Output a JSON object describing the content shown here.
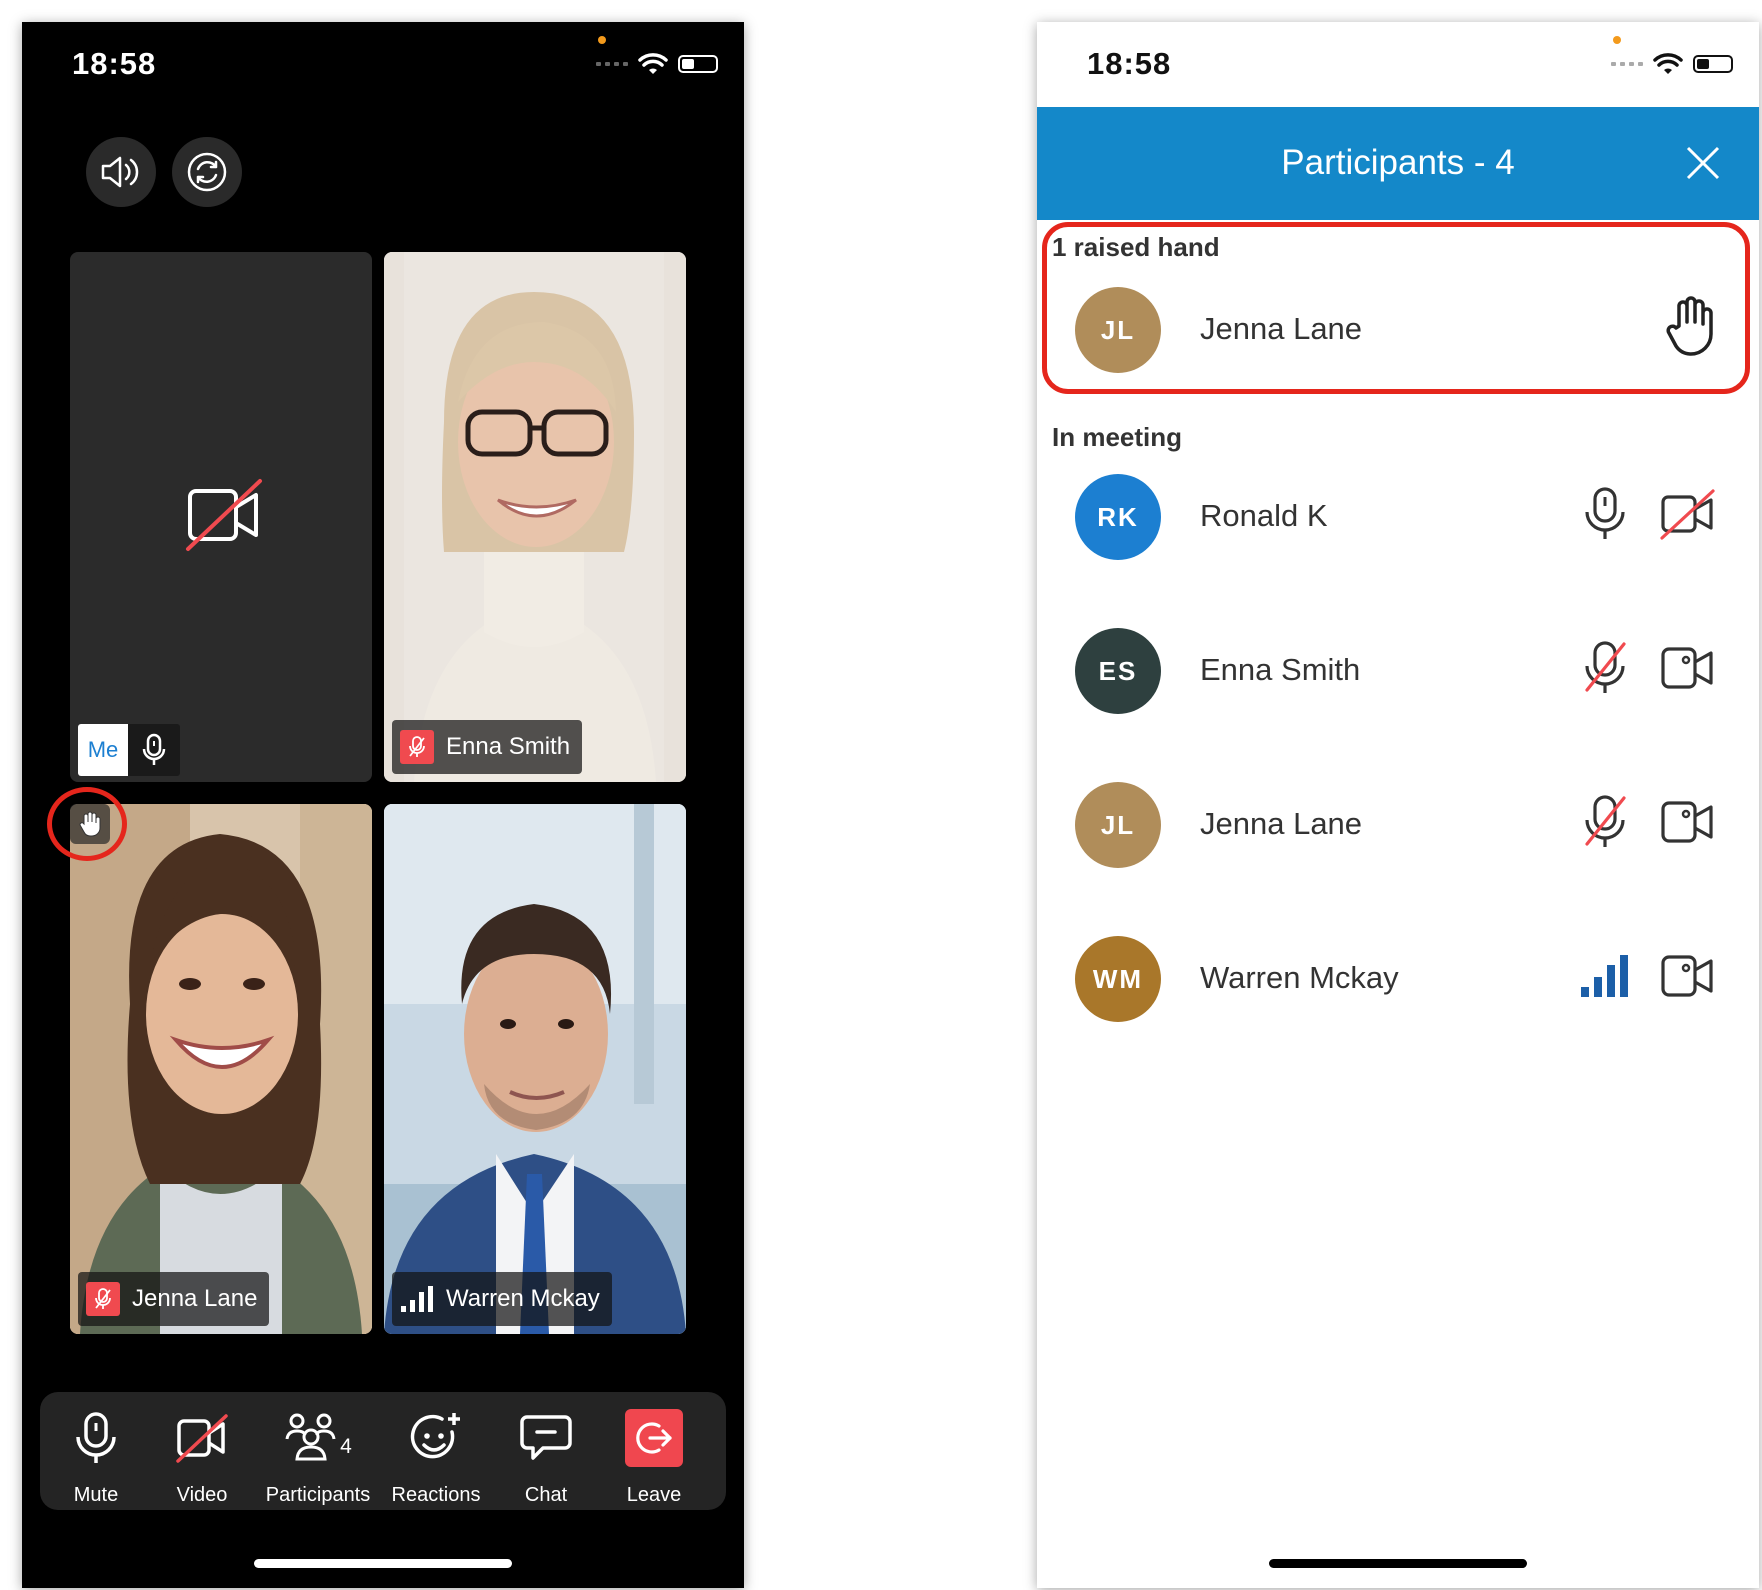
{
  "left_phone": {
    "status": {
      "time": "18:58"
    },
    "self_tile": {
      "me_label": "Me"
    },
    "tiles": [
      {
        "name": "Enna Smith"
      },
      {
        "name": "Jenna Lane"
      },
      {
        "name": "Warren Mckay"
      }
    ],
    "toolbar": {
      "mute": "Mute",
      "video": "Video",
      "participants": "Participants",
      "participants_count": "4",
      "reactions": "Reactions",
      "chat": "Chat",
      "leave": "Leave"
    }
  },
  "right_phone": {
    "status": {
      "time": "18:58"
    },
    "header": {
      "title": "Participants - 4"
    },
    "raised_section": {
      "label": "1 raised hand",
      "participant": {
        "initials": "JL",
        "name": "Jenna Lane",
        "color": "#b08d5a"
      }
    },
    "meeting_section": {
      "label": "In meeting",
      "participants": [
        {
          "initials": "RK",
          "name": "Ronald K",
          "color": "#1c7fd1",
          "mic": "on",
          "video": "off"
        },
        {
          "initials": "ES",
          "name": "Enna Smith",
          "color": "#2e403f",
          "mic": "muted",
          "video": "on"
        },
        {
          "initials": "JL",
          "name": "Jenna Lane",
          "color": "#b08d5a",
          "mic": "muted",
          "video": "on"
        },
        {
          "initials": "WM",
          "name": "Warren Mckay",
          "color": "#a9772a",
          "mic": "speaking",
          "video": "on"
        }
      ]
    }
  },
  "colors": {
    "accent_blue": "#1488c9",
    "leave_red": "#f0474f",
    "highlight_red": "#e5261c"
  }
}
